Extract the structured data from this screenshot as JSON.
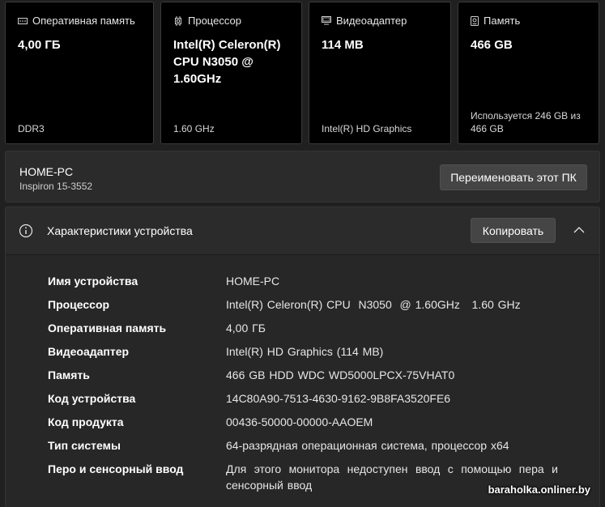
{
  "cards": [
    {
      "icon": "memory-icon",
      "title": "Оперативная память",
      "value": "4,00 ГБ",
      "foot": "DDR3"
    },
    {
      "icon": "cpu-icon",
      "title": "Процессор",
      "value": "Intel(R) Celeron(R) CPU  N3050  @ 1.60GHz",
      "foot": "1.60 GHz"
    },
    {
      "icon": "monitor-icon",
      "title": "Видеоадаптер",
      "value": "114 MB",
      "foot": "Intel(R) HD Graphics"
    },
    {
      "icon": "storage-icon",
      "title": "Память",
      "value": "466 GB",
      "foot": "Используется 246 GB из 466 GB"
    }
  ],
  "pc": {
    "name": "HOME-PC",
    "model": "Inspiron 15-3552",
    "rename_label": "Переименовать этот ПК"
  },
  "specs": {
    "title": "Характеристики устройства",
    "copy_label": "Копировать",
    "rows": [
      {
        "k": "Имя устройства",
        "v": "HOME-PC"
      },
      {
        "k": "Процессор",
        "v": "Intel(R) Celeron(R) CPU  N3050  @ 1.60GHz   1.60 GHz"
      },
      {
        "k": "Оперативная память",
        "v": "4,00 ГБ"
      },
      {
        "k": "Видеоадаптер",
        "v": "Intel(R) HD Graphics (114 MB)"
      },
      {
        "k": "Память",
        "v": "466 GB HDD WDC WD5000LPCX-75VHAT0"
      },
      {
        "k": "Код устройства",
        "v": "14C80A90-7513-4630-9162-9B8FA3520FE6"
      },
      {
        "k": "Код продукта",
        "v": "00436-50000-00000-AAOEM"
      },
      {
        "k": "Тип системы",
        "v": "64-разрядная операционная система, процессор x64"
      },
      {
        "k": "Перо и сенсорный ввод",
        "v": "Для этого монитора недоступен ввод с помощью пера и сенсорный ввод"
      }
    ]
  },
  "watermark": "baraholka.onliner.by"
}
